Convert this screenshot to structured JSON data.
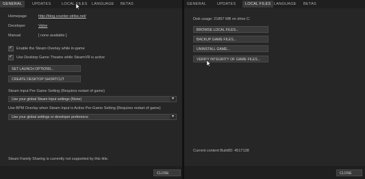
{
  "left": {
    "tabs": [
      "GENERAL",
      "UPDATES",
      "LOCAL FILES",
      "LANGUAGE",
      "BETAS"
    ],
    "active_tab": 0,
    "homepage_label": "Homepage",
    "homepage_value": "http://blog.counter-strike.net/",
    "developer_label": "Developer",
    "developer_value": "Valve",
    "manual_label": "Manual",
    "manual_value": "[ none available ]",
    "overlay_checkbox": "Enable the Steam Overlay while in-game",
    "theatre_checkbox": "Use Desktop Game Theatre while SteamVR is active",
    "launch_options_button": "SET LAUNCH OPTIONS...",
    "shortcut_button": "CREATE DESKTOP SHORTCUT",
    "steam_input_heading": "Steam Input Per-Game Setting (Requires restart of game)",
    "steam_input_select": "Use your global Steam Input settings (None)",
    "bpm_heading": "Use BPM Overlay when Steam Input is Active Per-Game Setting (Requires restart of game)",
    "bpm_select": "Use your global settings or developer preference",
    "family_sharing_note": "Steam Family Sharing is currently not supported by this title.",
    "close_button": "CLOSE"
  },
  "right": {
    "tabs": [
      "GENERAL",
      "UPDATES",
      "LOCAL FILES",
      "LANGUAGE",
      "BETAS"
    ],
    "active_tab": 2,
    "disk_usage": "Disk usage: 21867 MB on drive C:",
    "browse_button": "BROWSE LOCAL FILES...",
    "backup_button": "BACKUP GAME FILES...",
    "uninstall_button": "UNINSTALL GAME...",
    "verify_button": "VERIFY INTEGRITY OF GAME FILES...",
    "build_id": "Current content BuildID: 4517138",
    "close_button": "CLOSE"
  },
  "icons": {
    "checkbox": "check-icon",
    "dropdown": "chevron-down-icon",
    "cursor": "mouse-pointer-icon"
  },
  "colors": {
    "window_bg": "#262626",
    "tabbar_bg": "#1f1f1f",
    "button_bg": "#3a3a3a",
    "text": "#c8c8c8"
  }
}
